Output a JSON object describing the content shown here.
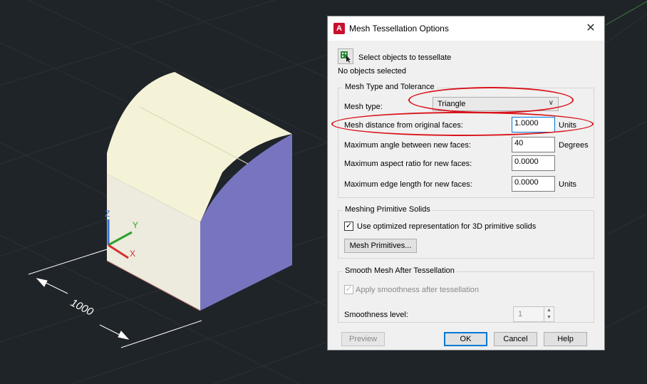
{
  "viewport": {
    "dimension_label": "1000",
    "axis_labels": {
      "z": "Z",
      "y": "Y",
      "x": "X"
    }
  },
  "dialog": {
    "title": "Mesh Tessellation Options",
    "app_icon_letter": "A",
    "close_glyph": "✕",
    "select_objects_label": "Select objects to tessellate",
    "selection_status": "No objects selected",
    "mesh_type_group": {
      "title": "Mesh Type and Tolerance",
      "mesh_type_label": "Mesh type:",
      "mesh_type_value": "Triangle",
      "distance_label": "Mesh distance from original faces:",
      "distance_value": "1.0000",
      "distance_unit": "Units",
      "angle_label": "Maximum angle between new faces:",
      "angle_value": "40",
      "angle_unit": "Degrees",
      "aspect_label": "Maximum aspect ratio for new faces:",
      "aspect_value": "0.0000",
      "edge_label": "Maximum edge length for new faces:",
      "edge_value": "0.0000",
      "edge_unit": "Units"
    },
    "primitive_group": {
      "title": "Meshing Primitive Solids",
      "optimized_checkbox_label": "Use optimized representation for 3D primitive solids",
      "optimized_checked": true,
      "mesh_primitives_button": "Mesh Primitives..."
    },
    "smooth_group": {
      "title": "Smooth Mesh After Tessellation",
      "apply_checkbox_label": "Apply smoothness after tessellation",
      "apply_checked": true,
      "smoothness_label": "Smoothness level:",
      "smoothness_value": "1"
    },
    "buttons": {
      "preview": "Preview",
      "ok": "OK",
      "cancel": "Cancel",
      "help": "Help"
    }
  },
  "colors": {
    "background": "#1f2429",
    "annotation": "#d9141b",
    "solid_top": "#f4f3d8",
    "solid_front": "#ecebdd",
    "solid_side": "#7875c0"
  }
}
